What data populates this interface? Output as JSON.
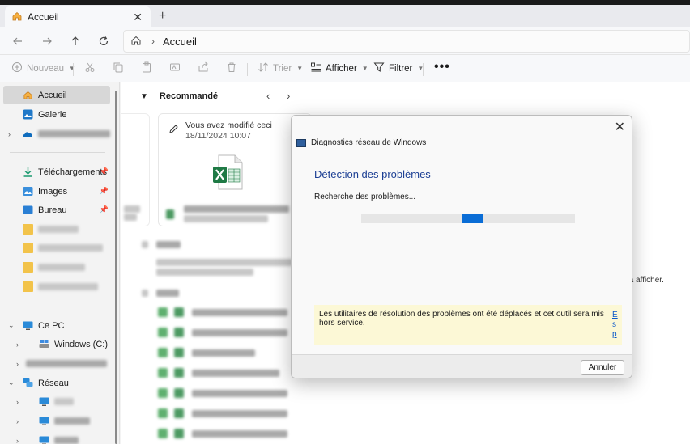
{
  "tab": {
    "title": "Accueil",
    "close_glyph": "✕",
    "new_glyph": "+"
  },
  "address": {
    "crumb": "Accueil",
    "separator": "›"
  },
  "commands": {
    "new_label": "Nouveau",
    "sort_label": "Trier",
    "view_label": "Afficher",
    "filter_label": "Filtrer",
    "more_glyph": "•••"
  },
  "sidebar": {
    "home": "Accueil",
    "gallery": "Galerie",
    "downloads": "Téléchargements",
    "images": "Images",
    "desktop": "Bureau",
    "this_pc": "Ce PC",
    "windows_drive": "Windows  (C:)",
    "network": "Réseau"
  },
  "recommended": {
    "heading": "Recommandé",
    "card_title": "Vous avez modifié ceci",
    "card_date": "18/11/2024 10:07"
  },
  "main_right_text": "er à afficher.",
  "dialog": {
    "title": "Diagnostics réseau de Windows",
    "heading": "Détection des problèmes",
    "status": "Recherche des problèmes...",
    "progress": 0.1,
    "warning": "Les utilitaires de résolution des problèmes ont été déplacés et cet outil sera mis hors service.",
    "warning_link": "Esp",
    "cancel_label": "Annuler",
    "close_glyph": "✕"
  },
  "colors": {
    "accent": "#0a6dd6",
    "heading_blue": "#1c3f94",
    "warning_bg": "#fcf8d6",
    "excel_green": "#1f7a45",
    "folder_yellow": "#f2c34a"
  },
  "icons": {
    "home": "home-icon",
    "gallery": "gallery-icon",
    "cloud": "onedrive-icon",
    "download": "download-icon",
    "images": "images-icon",
    "desktop": "desktop-icon",
    "pc": "computer-icon",
    "drive": "drive-icon",
    "network": "network-icon",
    "excel": "excel-icon"
  }
}
